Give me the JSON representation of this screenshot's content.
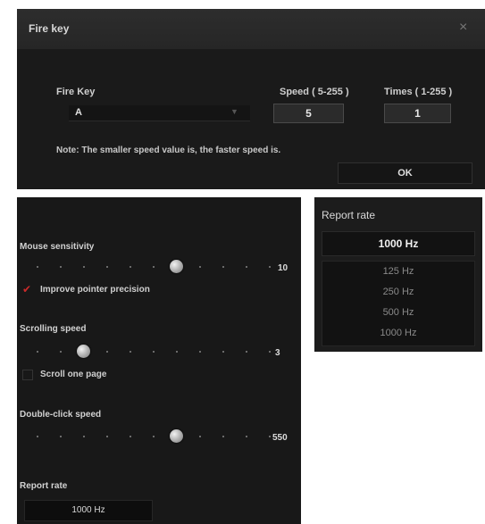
{
  "fire_key_dialog": {
    "title": "Fire key",
    "close_glyph": "×",
    "fire_key_label": "Fire Key",
    "fire_key_value": "A",
    "speed_label": "Speed ( 5-255 )",
    "speed_value": "5",
    "times_label": "Times ( 1-255 )",
    "times_value": "1",
    "note": "Note:  The smaller speed value is, the faster speed is.",
    "ok_label": "OK"
  },
  "mouse_settings": {
    "sensitivity": {
      "label": "Mouse sensitivity",
      "value": "10",
      "level_index": 6,
      "steps": 11
    },
    "improve_precision": {
      "label": "Improve pointer precision",
      "checked": true,
      "check_glyph": "✔"
    },
    "scrolling": {
      "label": "Scrolling speed",
      "value": "3",
      "level_index": 2,
      "steps": 11
    },
    "scroll_one_page": {
      "label": "Scroll one page",
      "checked": false
    },
    "double_click": {
      "label": "Double-click speed",
      "value": "550",
      "level_index": 6,
      "steps": 11
    },
    "report_rate": {
      "label": "Report rate",
      "value": "1000 Hz"
    }
  },
  "report_rate_dropdown": {
    "header": "Report rate",
    "selected": "1000 Hz",
    "options": [
      "125 Hz",
      "250 Hz",
      "500 Hz",
      "1000 Hz"
    ]
  },
  "colors": {
    "accent_check": "#cc2a2a",
    "panel_bg": "#181818"
  }
}
